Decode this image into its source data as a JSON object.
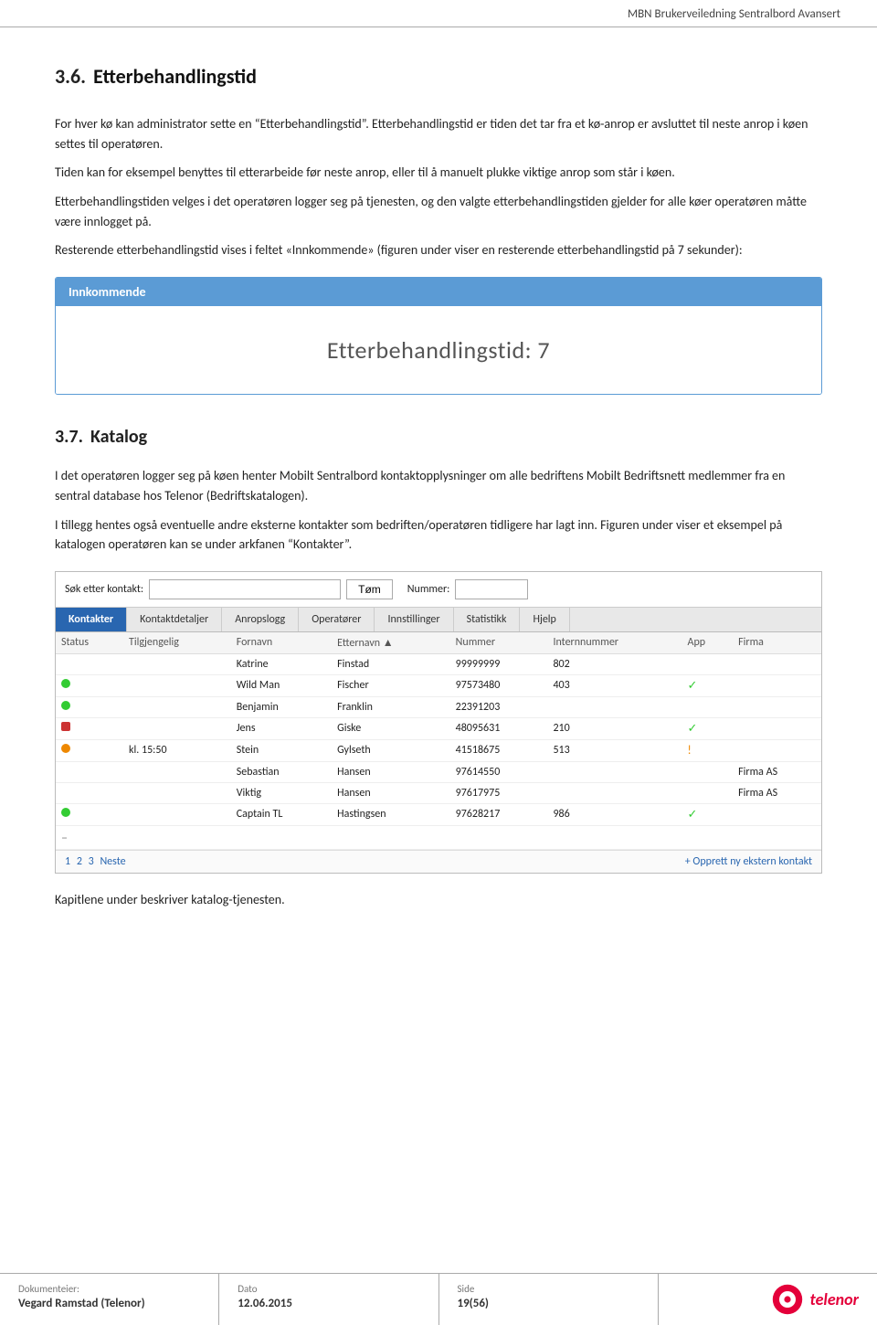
{
  "header": {
    "title": "MBN Brukerveiledning Sentralbord Avansert"
  },
  "section36": {
    "number": "3.6.",
    "title": "Etterbehandlingstid",
    "para1": "For hver kø kan administrator sette en “Etterbehandlingstid”. Etterbehandlingstid er tiden det tar fra et kø-anrop er avsluttet til neste anrop i køen settes til operatøren.",
    "para2": "Tiden kan for eksempel benyttes til etterarbeide før neste anrop, eller til å manuelt plukke viktige anrop som står i køen.",
    "para3": "Etterbehandlingstiden velges i det operatøren logger seg på tjenesten, og den valgte etterbehandlingstiden gjelder for alle køer operatøren måtte være innlogget på.",
    "para4": "Resterende etterbehandlingstid vises i feltet «Innkommende» (figuren under viser en resterende etterbehandlingstid på 7 sekunder):"
  },
  "innkommende": {
    "header": "Innkommende",
    "body": "Etterbehandlingstid: 7"
  },
  "section37": {
    "number": "3.7.",
    "title": "Katalog",
    "para1": "I det operatøren logger seg på køen henter Mobilt Sentralbord kontaktopplysninger om alle bedriftens Mobilt Bedriftsnett medlemmer fra en sentral database hos Telenor (Bedriftskatalogen).",
    "para2": "I tillegg hentes også eventuelle andre eksterne kontakter som bedriften/operatøren tidligere har lagt inn. Figuren under viser et eksempel på katalogen operatøren kan se under arkfanen “Kontakter”."
  },
  "catalog": {
    "search_label": "Søk etter kontakt:",
    "search_placeholder": "",
    "clear_button": "Tøm",
    "nummer_label": "Nummer:",
    "tabs": [
      "Kontakter",
      "Kontaktdetaljer",
      "Anropslogg",
      "Operatører",
      "Innstillinger",
      "Statistikk",
      "Hjelp"
    ],
    "active_tab": "Kontakter",
    "columns": [
      "Status",
      "Tilgjengelig",
      "Fornavn",
      "Etternavn ▲",
      "Nummer",
      "Internnummer",
      "App",
      "Firma"
    ],
    "rows": [
      {
        "status": "none",
        "tilgjengelig": "",
        "fornavn": "Katrine",
        "etternavn": "Finstad",
        "nummer": "99999999",
        "internnummer": "802",
        "app": "",
        "firma": ""
      },
      {
        "status": "green",
        "tilgjengelig": "",
        "fornavn": "Wild Man",
        "etternavn": "Fischer",
        "nummer": "97573480",
        "internnummer": "403",
        "app": "✓",
        "firma": ""
      },
      {
        "status": "green",
        "tilgjengelig": "",
        "fornavn": "Benjamin",
        "etternavn": "Franklin",
        "nummer": "22391203",
        "internnummer": "",
        "app": "",
        "firma": ""
      },
      {
        "status": "red",
        "tilgjengelig": "",
        "fornavn": "Jens",
        "etternavn": "Giske",
        "nummer": "48095631",
        "internnummer": "210",
        "app": "✓",
        "firma": ""
      },
      {
        "status": "orange",
        "tilgjengelig": "kl. 15:50",
        "fornavn": "Stein",
        "etternavn": "Gylseth",
        "nummer": "41518675",
        "internnummer": "513",
        "app": "!",
        "firma": ""
      },
      {
        "status": "none",
        "tilgjengelig": "",
        "fornavn": "Sebastian",
        "etternavn": "Hansen",
        "nummer": "97614550",
        "internnummer": "",
        "app": "",
        "firma": "Firma AS"
      },
      {
        "status": "none",
        "tilgjengelig": "",
        "fornavn": "Viktig",
        "etternavn": "Hansen",
        "nummer": "97617975",
        "internnummer": "",
        "app": "",
        "firma": "Firma AS"
      },
      {
        "status": "green",
        "tilgjengelig": "",
        "fornavn": "Captain TL",
        "etternavn": "Hastingsen",
        "nummer": "97628217",
        "internnummer": "986",
        "app": "✓",
        "firma": ""
      },
      {
        "status": "dash",
        "tilgjengelig": "",
        "fornavn": "–",
        "etternavn": "–",
        "nummer": "–",
        "internnummer": "–",
        "app": "",
        "firma": ""
      }
    ],
    "footer_pages": [
      "1",
      "2",
      "3",
      "Neste"
    ],
    "footer_link": "+ Opprett ny ekstern kontakt"
  },
  "conclusion": {
    "text": "Kapitlene under beskriver katalog-tjenesten."
  },
  "footer": {
    "doc_label": "Dokumenteier:",
    "doc_value": "Vegard Ramstad (Telenor)",
    "date_label": "Dato",
    "date_value": "12.06.2015",
    "page_label": "Side",
    "page_value": "19(56)",
    "logo_text": "telenor"
  }
}
